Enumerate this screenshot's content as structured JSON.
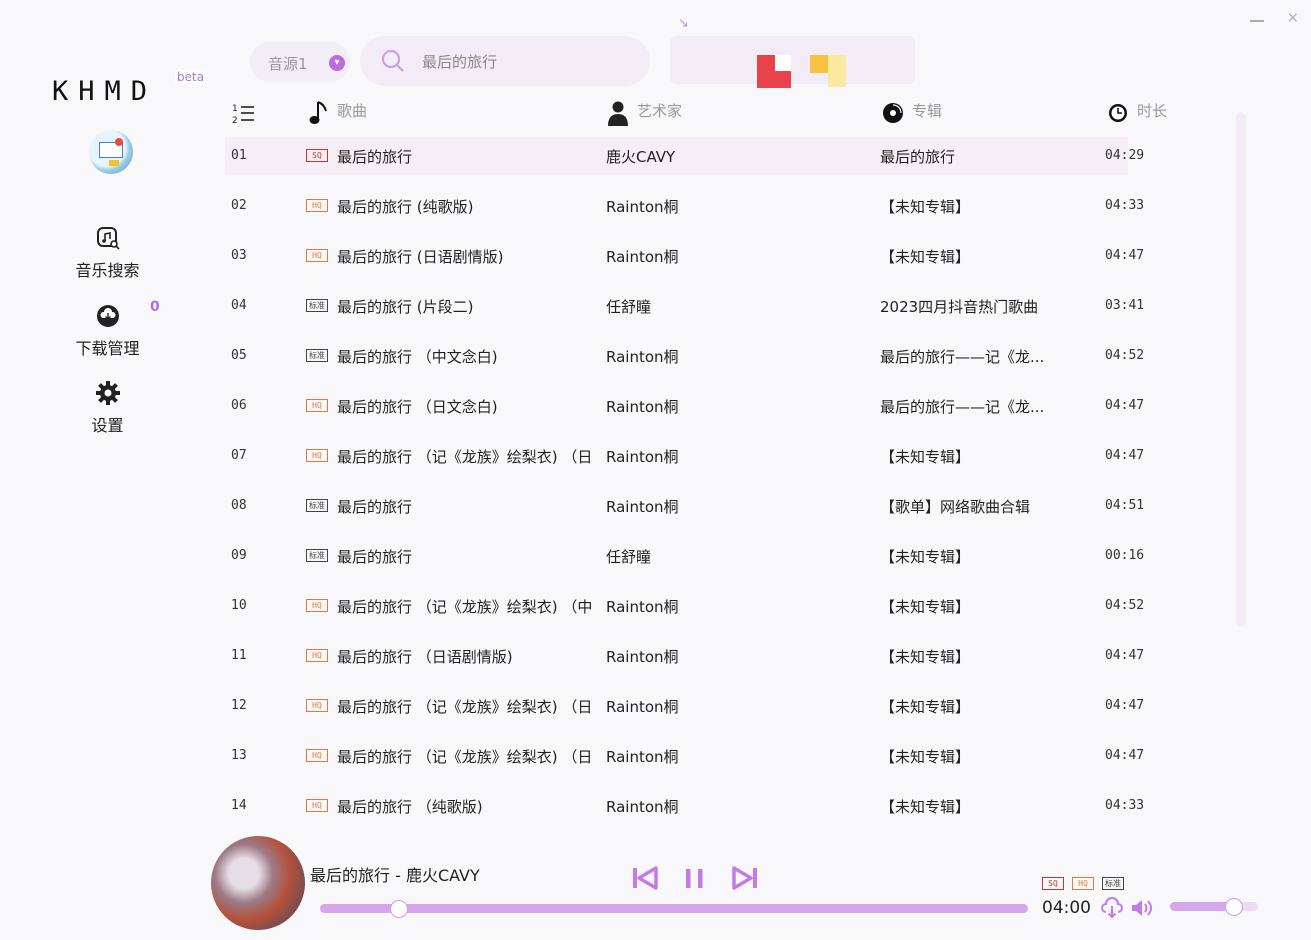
{
  "app": {
    "logo": "KHMD",
    "beta": "beta",
    "min": "–",
    "close": "×",
    "top_mark": "↘"
  },
  "sidebar": {
    "search": "音乐搜索",
    "download": "下载管理",
    "download_count": "0",
    "settings": "设置"
  },
  "topbar": {
    "source": "音源1",
    "search_value": "最后的旅行"
  },
  "header": {
    "song": "歌曲",
    "artist": "艺术家",
    "album": "专辑",
    "duration": "时长"
  },
  "tags": {
    "sq": "SQ",
    "hq": "HQ",
    "std": "标准"
  },
  "songs": [
    {
      "num": "01",
      "tag": "SQ",
      "title": "最后的旅行",
      "artist": "鹿火CAVY",
      "album": "最后的旅行",
      "dur": "04:29"
    },
    {
      "num": "02",
      "tag": "HQ",
      "title": "最后的旅行 (纯歌版)",
      "artist": "Rainton桐",
      "album": "【未知专辑】",
      "dur": "04:33"
    },
    {
      "num": "03",
      "tag": "HQ",
      "title": "最后的旅行 (日语剧情版)",
      "artist": "Rainton桐",
      "album": "【未知专辑】",
      "dur": "04:47"
    },
    {
      "num": "04",
      "tag": "标准",
      "title": "最后的旅行 (片段二)",
      "artist": "任舒瞳",
      "album": "2023四月抖音热门歌曲",
      "dur": "03:41"
    },
    {
      "num": "05",
      "tag": "标准",
      "title": "最后的旅行 （中文念白)",
      "artist": "Rainton桐",
      "album": "最后的旅行——记《龙...",
      "dur": "04:52"
    },
    {
      "num": "06",
      "tag": "HQ",
      "title": "最后的旅行 （日文念白)",
      "artist": "Rainton桐",
      "album": "最后的旅行——记《龙...",
      "dur": "04:47"
    },
    {
      "num": "07",
      "tag": "HQ",
      "title": "最后的旅行 （记《龙族》绘梨衣) （日",
      "artist": "Rainton桐",
      "album": "【未知专辑】",
      "dur": "04:47"
    },
    {
      "num": "08",
      "tag": "标准",
      "title": "最后的旅行",
      "artist": "Rainton桐",
      "album": "【歌单】网络歌曲合辑",
      "dur": "04:51"
    },
    {
      "num": "09",
      "tag": "标准",
      "title": "最后的旅行",
      "artist": "任舒瞳",
      "album": "【未知专辑】",
      "dur": "00:16"
    },
    {
      "num": "10",
      "tag": "HQ",
      "title": "最后的旅行 （记《龙族》绘梨衣) （中",
      "artist": "Rainton桐",
      "album": "【未知专辑】",
      "dur": "04:52"
    },
    {
      "num": "11",
      "tag": "HQ",
      "title": "最后的旅行 （日语剧情版)",
      "artist": "Rainton桐",
      "album": "【未知专辑】",
      "dur": "04:47"
    },
    {
      "num": "12",
      "tag": "HQ",
      "title": "最后的旅行 （记《龙族》绘梨衣) （日",
      "artist": "Rainton桐",
      "album": "【未知专辑】",
      "dur": "04:47"
    },
    {
      "num": "13",
      "tag": "HQ",
      "title": "最后的旅行 （记《龙族》绘梨衣) （日",
      "artist": "Rainton桐",
      "album": "【未知专辑】",
      "dur": "04:47"
    },
    {
      "num": "14",
      "tag": "HQ",
      "title": "最后的旅行 （纯歌版)",
      "artist": "Rainton桐",
      "album": "【未知专辑】",
      "dur": "04:33"
    }
  ],
  "selected_row": "01",
  "player": {
    "now_playing": "最后的旅行 - 鹿火CAVY",
    "time": "04:00",
    "progress_fraction": 0.11,
    "volume_fraction": 0.72
  },
  "colors": {
    "accent": "#b86ee0",
    "sq": "#c0392b",
    "hq": "#e07a3a",
    "std": "#444444",
    "selected_row": "#f6eef6"
  }
}
